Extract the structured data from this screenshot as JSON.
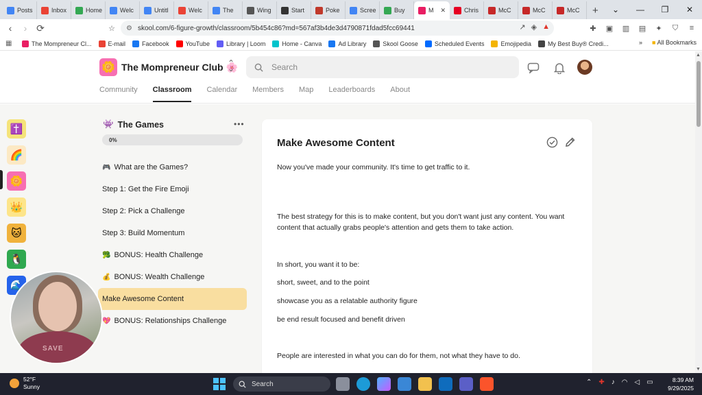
{
  "browser": {
    "tabs": [
      {
        "label": "Posts",
        "color": "#4285f4"
      },
      {
        "label": "Inbox",
        "color": "#ea4335"
      },
      {
        "label": "Home",
        "color": "#34a853"
      },
      {
        "label": "Welc",
        "color": "#4285f4"
      },
      {
        "label": "Untitl",
        "color": "#4285f4"
      },
      {
        "label": "Welc",
        "color": "#ea4335"
      },
      {
        "label": "The",
        "color": "#4285f4"
      },
      {
        "label": "Wing",
        "color": "#555555"
      },
      {
        "label": "Start",
        "color": "#333333"
      },
      {
        "label": "Poke",
        "color": "#c0392b"
      },
      {
        "label": "Scree",
        "color": "#4285f4"
      },
      {
        "label": "Buy",
        "color": "#34a853"
      },
      {
        "label": "M",
        "color": "#e91e63",
        "active": true
      },
      {
        "label": "Chris",
        "color": "#e60023"
      },
      {
        "label": "McC",
        "color": "#c62828"
      },
      {
        "label": "McC",
        "color": "#c62828"
      },
      {
        "label": "McC",
        "color": "#c62828"
      }
    ],
    "url": "skool.com/6-figure-growth/classroom/5b454c86?md=567af3b4de3d4790871fdad5fcc69441",
    "bookmarks": [
      {
        "label": "The Mompreneur Cl...",
        "color": "#e91e63"
      },
      {
        "label": "E-mail",
        "color": "#ea4335"
      },
      {
        "label": "Facebook",
        "color": "#1877f2"
      },
      {
        "label": "YouTube",
        "color": "#ff0000"
      },
      {
        "label": "Library | Loom",
        "color": "#625df5"
      },
      {
        "label": "Home - Canva",
        "color": "#00c4cc"
      },
      {
        "label": "Ad Library",
        "color": "#1877f2"
      },
      {
        "label": "Skool Goose",
        "color": "#555555"
      },
      {
        "label": "Scheduled Events",
        "color": "#006bff"
      },
      {
        "label": "Emojipedia",
        "color": "#f4b400"
      },
      {
        "label": "My Best Buy® Credi...",
        "color": "#444444"
      }
    ],
    "bookmarks_more": "»",
    "all_bookmarks": "All Bookmarks"
  },
  "header": {
    "club_name": "The Mompreneur Club",
    "club_emoji": "🌸",
    "logo_emoji": "🌼",
    "search_placeholder": "Search",
    "nav": [
      "Community",
      "Classroom",
      "Calendar",
      "Members",
      "Map",
      "Leaderboards",
      "About"
    ],
    "active_nav": "Classroom"
  },
  "rail": {
    "communities": [
      {
        "emoji": "✝️",
        "bg": "#f5e37a"
      },
      {
        "emoji": "🌈",
        "bg": "#fce9c4"
      },
      {
        "emoji": "🌼",
        "bg": "#f76fb2"
      },
      {
        "emoji": "👑",
        "bg": "#fde58a"
      },
      {
        "emoji": "🐱",
        "bg": "#f0b23c"
      },
      {
        "emoji": "🐧",
        "bg": "#2fa84f"
      },
      {
        "emoji": "🌊",
        "bg": "#2563eb"
      }
    ]
  },
  "module": {
    "emoji": "👾",
    "title": "The Games",
    "menu": "•••",
    "progress": "0%",
    "lessons": [
      {
        "emoji": "🎮",
        "label": "What are the Games?"
      },
      {
        "emoji": "",
        "label": "Step 1: Get the Fire Emoji"
      },
      {
        "emoji": "",
        "label": "Step 2: Pick a Challenge"
      },
      {
        "emoji": "",
        "label": "Step 3: Build Momentum"
      },
      {
        "emoji": "🥦",
        "label": "BONUS: Health Challenge"
      },
      {
        "emoji": "💰",
        "label": "BONUS: Wealth Challenge"
      },
      {
        "emoji": "",
        "label": "Make Awesome Content",
        "active": true
      },
      {
        "emoji": "💖",
        "label": "BONUS: Relationships Challenge"
      }
    ]
  },
  "content": {
    "title": "Make Awesome Content",
    "paragraphs": [
      "Now you've made your community.  It's time to get traffic to it.",
      "The best strategy for this is to make content, but you don't want just any content.  You want content that actually grabs people's attention and gets them to take action.",
      "In short, you want it to be:",
      "short, sweet, and to the point",
      "showcase you as a relatable authority figure",
      "be end result focused and benefit driven",
      "People are interested in what you can do for them, not what they have to do."
    ]
  },
  "webcam": {
    "shirt_text": "SAVE"
  },
  "taskbar": {
    "temp": "52°F",
    "condition": "Sunny",
    "search": "Search",
    "time": "8:39 AM",
    "date": "9/29/2025"
  }
}
